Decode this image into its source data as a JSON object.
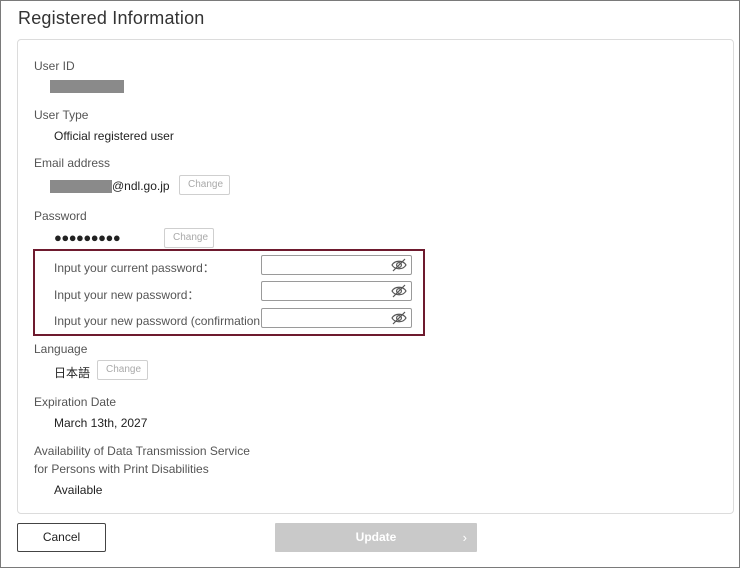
{
  "page": {
    "title": "Registered Information"
  },
  "user_id": {
    "label": "User ID"
  },
  "user_type": {
    "label": "User Type",
    "value": "Official registered user"
  },
  "email": {
    "label": "Email address",
    "domain": "@ndl.go.jp",
    "change_label": "Change"
  },
  "password": {
    "label": "Password",
    "masked": "●●●●●●●●●",
    "change_label": "Change",
    "current_label": "Input your current password：",
    "new_label": "Input your new password：",
    "confirm_label": "Input your new password (confirmation)：",
    "current_value": "",
    "new_value": "",
    "confirm_value": ""
  },
  "language": {
    "label": "Language",
    "value": "日本語",
    "change_label": "Change"
  },
  "expiration": {
    "label": "Expiration Date",
    "value": "March 13th, 2027"
  },
  "availability": {
    "label_line1": "Availability of Data Transmission Service",
    "label_line2": "for Persons with Print Disabilities",
    "value": "Available"
  },
  "footer": {
    "cancel_label": "Cancel",
    "update_label": "Update",
    "update_chevron": "›"
  },
  "colors": {
    "highlight_border": "#6e1a2e",
    "update_disabled_bg": "#c9c9c9",
    "redaction": "#8a8a8a"
  },
  "icons": {
    "password_toggle": "eye-slash-icon"
  }
}
